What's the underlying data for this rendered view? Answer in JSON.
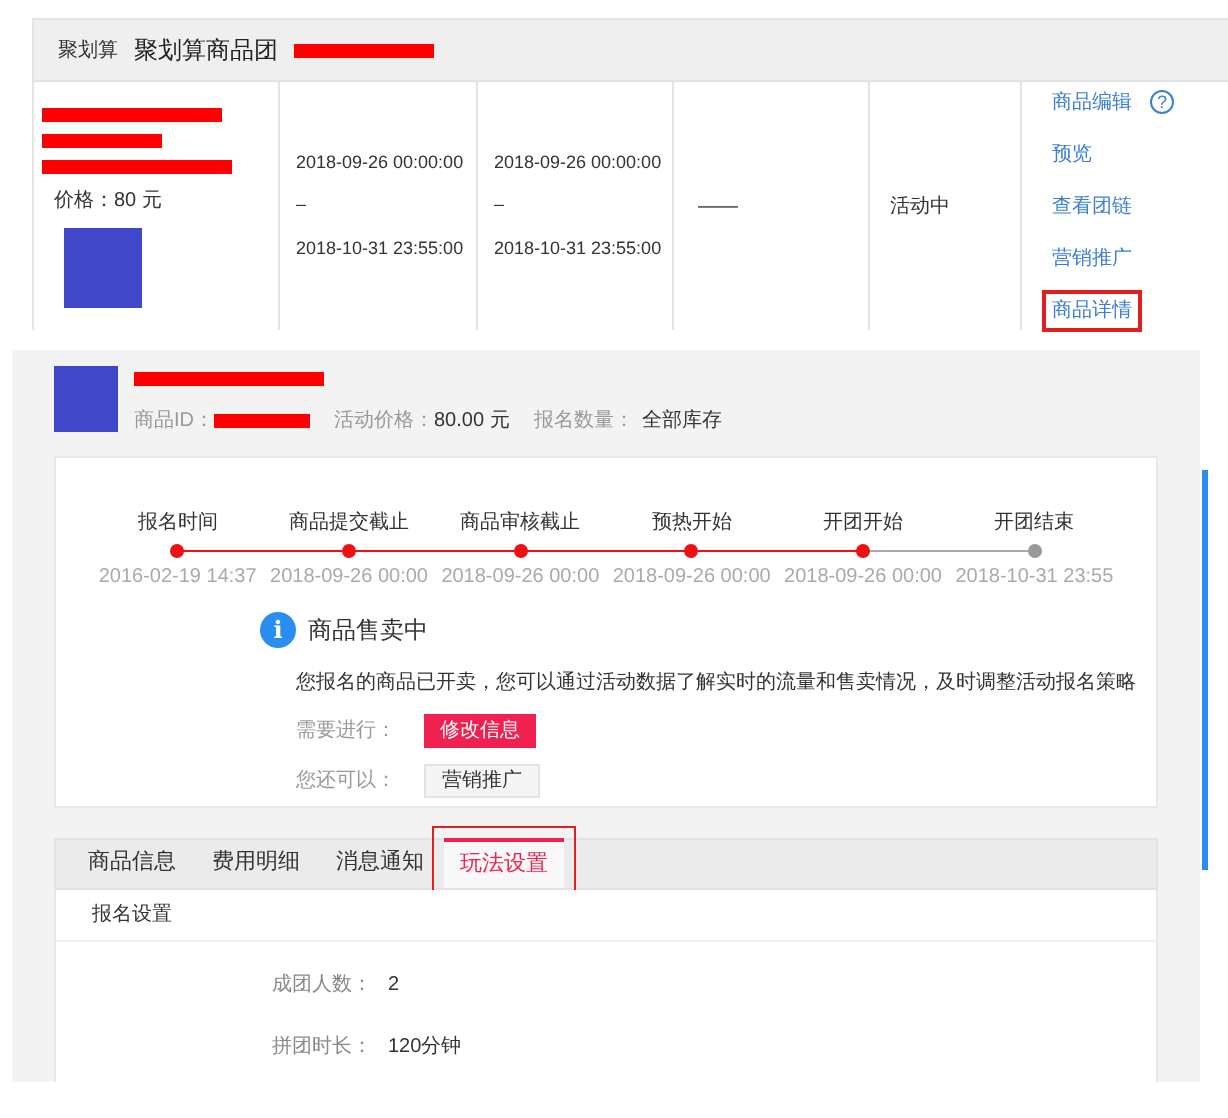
{
  "activity_list": {
    "header": {
      "tag": "聚划算",
      "title": "聚划算商品团"
    },
    "row": {
      "product": {
        "price": "价格：80 元"
      },
      "start_range": {
        "from": "2018-09-26 00:00:00",
        "sep": "–",
        "to": "2018-10-31 23:55:00"
      },
      "sale_range": {
        "from": "2018-09-26 00:00:00",
        "sep": "–",
        "to": "2018-10-31 23:55:00"
      },
      "column_4": "——",
      "status": "活动中",
      "actions": [
        {
          "label": "商品编辑",
          "help_icon": "?",
          "annotated": false
        },
        {
          "label": "预览",
          "annotated": false
        },
        {
          "label": "查看团链",
          "annotated": false
        },
        {
          "label": "营销推广",
          "annotated": false
        },
        {
          "label": "商品详情",
          "annotated": true
        }
      ]
    }
  },
  "detail": {
    "product": {
      "id_label": "商品ID：",
      "price_label": "活动价格：",
      "price": "80.00 元",
      "quantity_label": "报名数量：",
      "quantity": "全部库存"
    },
    "timeline": [
      {
        "label": "报名时间",
        "time": "2016-02-19 14:37",
        "done": true
      },
      {
        "label": "商品提交截止",
        "time": "2018-09-26 00:00",
        "done": true
      },
      {
        "label": "商品审核截止",
        "time": "2018-09-26 00:00",
        "done": true
      },
      {
        "label": "预热开始",
        "time": "2018-09-26 00:00",
        "done": true
      },
      {
        "label": "开团开始",
        "time": "2018-09-26 00:00",
        "done": true
      },
      {
        "label": "开团结束",
        "time": "2018-10-31 23:55",
        "done": false
      }
    ],
    "status": {
      "icon": "i",
      "title": "商品售卖中",
      "message": "您报名的商品已开卖，您可以通过活动数据了解实时的流量和售卖情况，及时调整活动报名策略",
      "actions": [
        {
          "label": "需要进行：",
          "button": "修改信息",
          "kind": "primary"
        },
        {
          "label": "您还可以：",
          "button": "营销推广",
          "kind": "secondary"
        }
      ]
    },
    "tabs": [
      {
        "label": "商品信息",
        "selected": false,
        "annotated": false
      },
      {
        "label": "费用明细",
        "selected": false,
        "annotated": false
      },
      {
        "label": "消息通知",
        "selected": false,
        "annotated": false
      },
      {
        "label": "玩法设置",
        "selected": true,
        "annotated": true
      }
    ],
    "section_title": "报名设置",
    "fields": [
      {
        "label": "成团人数：",
        "value": "2"
      },
      {
        "label": "拼团时长：",
        "value": "120分钟"
      }
    ]
  }
}
